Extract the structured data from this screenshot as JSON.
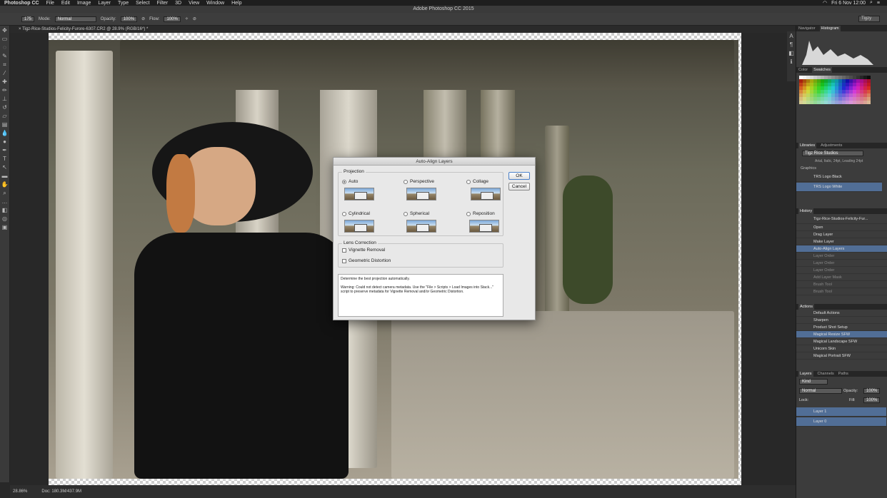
{
  "menubar": {
    "app": "Photoshop CC",
    "items": [
      "File",
      "Edit",
      "Image",
      "Layer",
      "Type",
      "Select",
      "Filter",
      "3D",
      "View",
      "Window",
      "Help"
    ],
    "clock": "Fri 6 Nov  12:00"
  },
  "window_title": "Adobe Photoshop CC 2015",
  "options": {
    "brush_size": "175",
    "mode_label": "Mode:",
    "mode_value": "Normal",
    "opacity_label": "Opacity:",
    "opacity_value": "100%",
    "flow_label": "Flow:",
    "flow_value": "100%",
    "workspace": "Tigzy"
  },
  "document_tab": "× Tigz-Rice-Studios-Felicity-Furore-6307.CR2 @ 28.9% (RGB/16*) *",
  "status": {
    "zoom": "28.86%",
    "doc": "Doc: 180.3M/437.9M"
  },
  "dialog": {
    "title": "Auto-Align Layers",
    "projection_label": "Projection",
    "options": [
      {
        "label": "Auto",
        "selected": true
      },
      {
        "label": "Perspective",
        "selected": false
      },
      {
        "label": "Collage",
        "selected": false
      },
      {
        "label": "Cylindrical",
        "selected": false
      },
      {
        "label": "Spherical",
        "selected": false
      },
      {
        "label": "Reposition",
        "selected": false
      }
    ],
    "lens_label": "Lens Correction",
    "vignette": "Vignette Removal",
    "geometric": "Geometric Distortion",
    "ok": "OK",
    "cancel": "Cancel",
    "info_line1": "Determine the best projection automatically.",
    "info_line2": "Warning: Could not detect camera metadata. Use the \"File > Scripts > Load Images into Stack...\" script to preserve metadata for Vignette Removal and/or Geometric Distortion."
  },
  "panels": {
    "navigator_tabs": [
      "Navigator",
      "Histogram"
    ],
    "color_tabs": [
      "Color",
      "Swatches"
    ],
    "libraries_tabs": [
      "Libraries",
      "Adjustments"
    ],
    "library_name": "Tigz Rice Studios",
    "library_font": "Arial, Italic, 24pt, Leading 24pt",
    "graphics_label": "Graphics",
    "graphics": [
      "TRS Logo Black",
      "TRS Logo White"
    ],
    "history_tab": "History",
    "history_doc": "Tigz-Rice-Studios-Felicity-Fur...",
    "history": [
      {
        "label": "Open",
        "state": "normal"
      },
      {
        "label": "Drag Layer",
        "state": "normal"
      },
      {
        "label": "Make Layer",
        "state": "normal"
      },
      {
        "label": "Auto-Align Layers",
        "state": "selected"
      },
      {
        "label": "Layer Order",
        "state": "dim"
      },
      {
        "label": "Layer Order",
        "state": "dim"
      },
      {
        "label": "Layer Order",
        "state": "dim"
      },
      {
        "label": "Add Layer Mask",
        "state": "dim"
      },
      {
        "label": "Brush Tool",
        "state": "dim"
      },
      {
        "label": "Brush Tool",
        "state": "dim"
      }
    ],
    "actions_tab": "Actions",
    "actions": [
      {
        "label": "Default Actions",
        "state": "normal"
      },
      {
        "label": "Sharpen",
        "state": "normal"
      },
      {
        "label": "Product Shot Setup",
        "state": "normal"
      },
      {
        "label": "Magical Resize SFW",
        "state": "selected"
      },
      {
        "label": "Magical Landscape SFW",
        "state": "normal"
      },
      {
        "label": "Unicorn Skin",
        "state": "normal"
      },
      {
        "label": "Magical Portrait SFW",
        "state": "normal"
      }
    ],
    "layers_tabs": [
      "Layers",
      "Channels",
      "Paths"
    ],
    "kind": "Kind",
    "blend": "Normal",
    "opacity_label": "Opacity:",
    "opacity": "100%",
    "lock_label": "Lock:",
    "fill_label": "Fill:",
    "fill": "100%",
    "layers": [
      "Layer 1",
      "Layer 0"
    ]
  }
}
